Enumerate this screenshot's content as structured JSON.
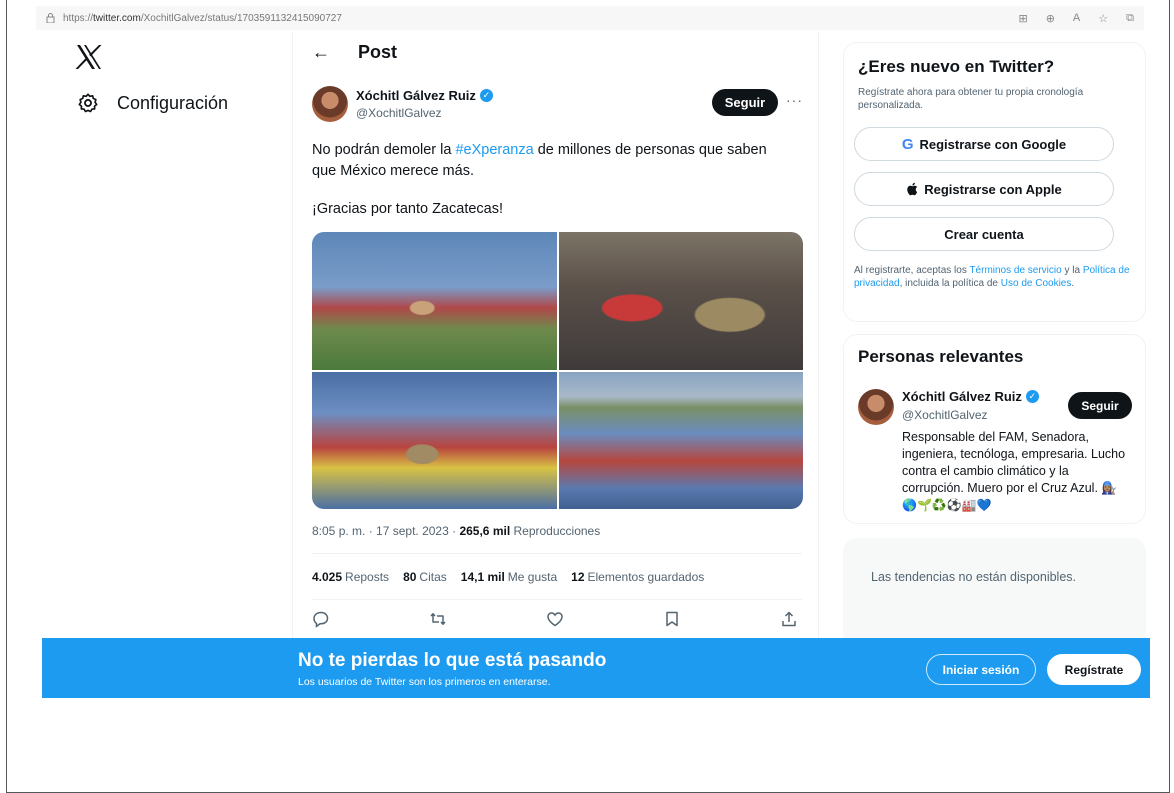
{
  "browser": {
    "url_prefix": "https://",
    "url_domain": "twitter.com",
    "url_path": "/XochitlGalvez/status/1703591132415090727"
  },
  "nav": {
    "config_label": "Configuración"
  },
  "post": {
    "back_glyph": "←",
    "header_title": "Post",
    "author_name": "Xóchitl Gálvez Ruiz",
    "author_handle": "@XochitlGalvez",
    "follow_label": "Seguir",
    "more_glyph": "···",
    "text_before": "No podrán demoler la ",
    "hashtag": "#eXperanza",
    "text_after": " de millones de personas que saben que México merece más.",
    "text_line2": "¡Gracias por tanto Zacatecas!",
    "time": "8:05 p. m.",
    "date": "17 sept. 2023",
    "views_count": "265,6 mil",
    "views_label": "Reproducciones",
    "reposts_count": "4.025",
    "reposts_label": "Reposts",
    "quotes_count": "80",
    "quotes_label": "Citas",
    "likes_count": "14,1 mil",
    "likes_label": "Me gusta",
    "saves_count": "12",
    "saves_label": "Elementos guardados"
  },
  "signup_card": {
    "title": "¿Eres nuevo en Twitter?",
    "subtitle": "Regístrate ahora para obtener tu propia cronología personalizada.",
    "google_label": "Registrarse con Google",
    "apple_label": "Registrarse con Apple",
    "create_label": "Crear cuenta",
    "legal_1": "Al registrarte, aceptas los ",
    "legal_terms": "Términos de servicio",
    "legal_2": " y la ",
    "legal_privacy": "Política de privacidad",
    "legal_3": ", incluida la política de ",
    "legal_cookies": "Uso de Cookies",
    "legal_4": "."
  },
  "relevant": {
    "title": "Personas relevantes",
    "name": "Xóchitl Gálvez Ruiz",
    "handle": "@XochitlGalvez",
    "follow_label": "Seguir",
    "bio": "Responsable del FAM, Senadora, ingeniera, tecnóloga, empresaria. Lucho contra el cambio climático y la corrupción. Muero por el Cruz Azul. 👩🏽‍🔧",
    "bio_emoji": "🌎🌱♻️⚽️🏭💙"
  },
  "trends": {
    "message": "Las tendencias no están disponibles."
  },
  "banner": {
    "headline": "No te pierdas lo que está pasando",
    "subline": "Los usuarios de Twitter son los primeros en enterarse.",
    "login_label": "Iniciar sesión",
    "register_label": "Regístrate"
  }
}
